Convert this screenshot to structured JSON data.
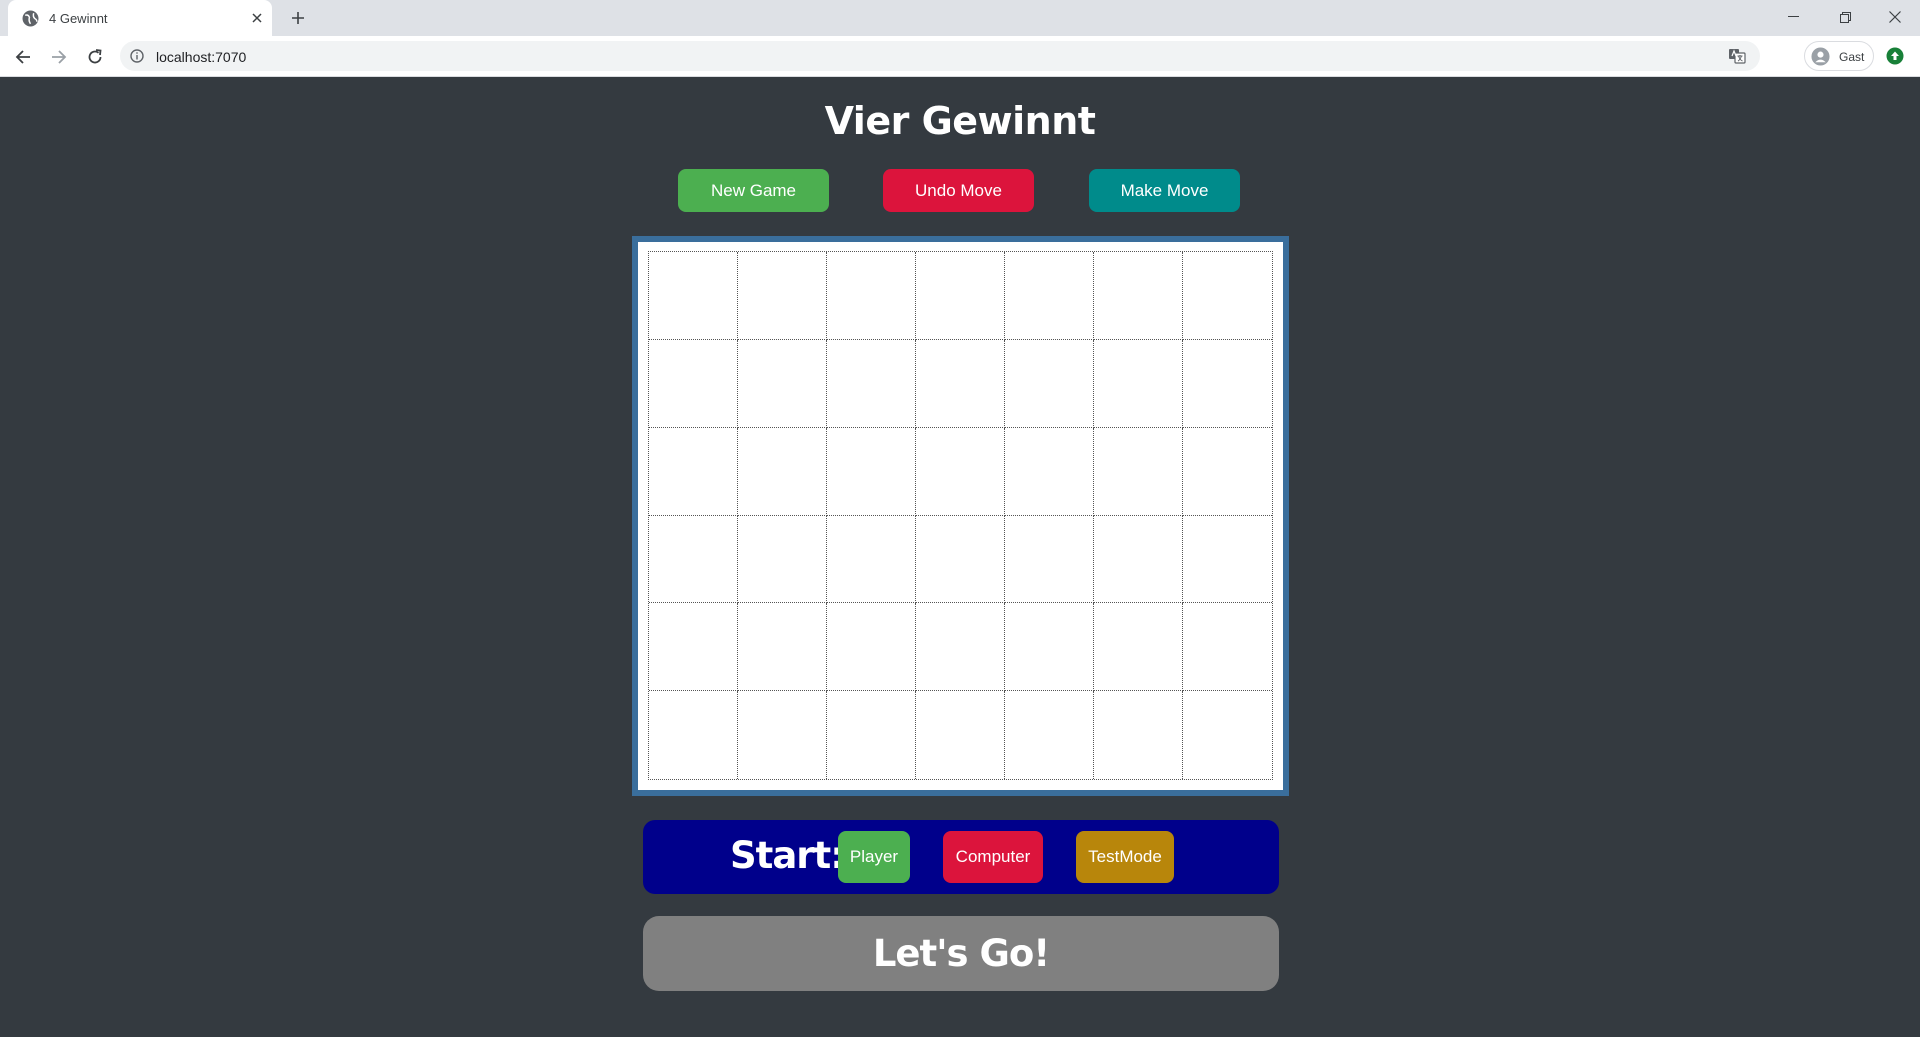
{
  "browser": {
    "tab_title": "4 Gewinnt",
    "url": "localhost:7070",
    "profile_label": "Gast"
  },
  "app": {
    "title": "Vier Gewinnt",
    "controls": {
      "new_game": "New Game",
      "undo_move": "Undo Move",
      "make_move": "Make Move"
    },
    "board": {
      "columns": 7,
      "rows": 6,
      "cells": []
    },
    "start": {
      "label": "Start:",
      "options": [
        "Player",
        "Computer",
        "TestMode"
      ]
    },
    "go_button": "Let's Go!"
  },
  "colors": {
    "background": "#343a40",
    "new_game": "#4caf50",
    "undo_move": "#dc143c",
    "make_move": "#008b8b",
    "board_border": "#3a6e9c",
    "start_bar": "#00008b",
    "player": "#4caf50",
    "computer": "#dc143c",
    "testmode": "#b8860b",
    "go_button": "#808080"
  }
}
